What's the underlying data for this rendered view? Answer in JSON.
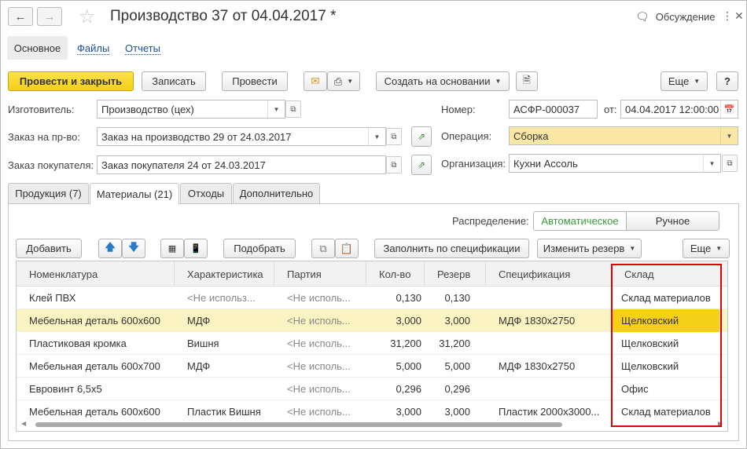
{
  "window": {
    "title": "Производство 37 от 04.04.2017 *",
    "discuss_label": "Обсуждение",
    "back_icon": "arrow-left-icon",
    "forward_icon": "arrow-right-icon"
  },
  "sections": {
    "main": "Основное",
    "files": "Файлы",
    "reports": "Отчеты"
  },
  "toolbar": {
    "post_close": "Провести и закрыть",
    "save": "Записать",
    "post": "Провести",
    "create_based": "Создать на основании",
    "more": "Еще"
  },
  "form": {
    "manufacturer_label": "Изготовитель:",
    "manufacturer_value": "Производство (цех)",
    "prod_order_label": "Заказ на пр-во:",
    "prod_order_value": "Заказ на производство 29 от 24.03.2017",
    "cust_order_label": "Заказ покупателя:",
    "cust_order_value": "Заказ покупателя 24 от 24.03.2017",
    "number_label": "Номер:",
    "number_value": "АСФР-000037",
    "date_label": "от:",
    "date_value": "04.04.2017 12:00:00",
    "operation_label": "Операция:",
    "operation_value": "Сборка",
    "org_label": "Организация:",
    "org_value": "Кухни Ассоль"
  },
  "tabs": [
    {
      "label": "Продукция (7)"
    },
    {
      "label": "Материалы (21)"
    },
    {
      "label": "Отходы"
    },
    {
      "label": "Дополнительно"
    }
  ],
  "distribution": {
    "label": "Распределение:",
    "auto": "Автоматическое",
    "manual": "Ручное"
  },
  "table_toolbar": {
    "add": "Добавить",
    "pick": "Подобрать",
    "fill_spec": "Заполнить по спецификации",
    "change_reserve": "Изменить резерв",
    "more": "Еще"
  },
  "table": {
    "columns": [
      "Номенклатура",
      "Характеристика",
      "Партия",
      "Кол-во",
      "Резерв",
      "Спецификация",
      "Склад"
    ],
    "rows": [
      {
        "nom": "Клей ПВХ",
        "char": "<Не использ...",
        "batch": "<Не исполь...",
        "qty": "0,130",
        "reserve": "0,130",
        "spec": "",
        "wh": "Склад материалов"
      },
      {
        "nom": "Мебельная деталь 600х600",
        "char": "МДФ",
        "batch": "<Не исполь...",
        "qty": "3,000",
        "reserve": "3,000",
        "spec": "МДФ 1830х2750",
        "wh": "Щелковский"
      },
      {
        "nom": "Пластиковая кромка",
        "char": "Вишня",
        "batch": "<Не исполь...",
        "qty": "31,200",
        "reserve": "31,200",
        "spec": "",
        "wh": "Щелковский"
      },
      {
        "nom": "Мебельная деталь 600х700",
        "char": "МДФ",
        "batch": "<Не исполь...",
        "qty": "5,000",
        "reserve": "5,000",
        "spec": "МДФ 1830х2750",
        "wh": "Щелковский"
      },
      {
        "nom": "Евровинт 6,5х5",
        "char": "",
        "batch": "<Не исполь...",
        "qty": "0,296",
        "reserve": "0,296",
        "spec": "",
        "wh": "Офис"
      },
      {
        "nom": "Мебельная деталь 600х600",
        "char": "Пластик Вишня",
        "batch": "<Не исполь...",
        "qty": "3,000",
        "reserve": "3,000",
        "spec": "Пластик 2000х3000...",
        "wh": "Склад материалов"
      }
    ]
  },
  "colors": {
    "primary_button": "#f5cf18",
    "selected_row": "#fbf3c2",
    "selected_cell": "#f5cf18",
    "highlight_field": "#fbe7a5",
    "link": "#1a4e9c",
    "annotation_box": "#e00000"
  }
}
